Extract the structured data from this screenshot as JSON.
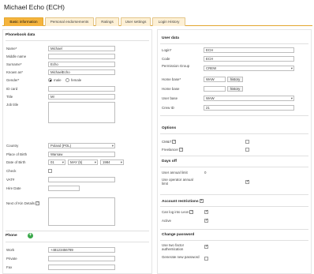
{
  "title": "Michael Echo (ECH)",
  "tabs": [
    "Basic information",
    "Personal endorsements",
    "Ratings",
    "User settings",
    "Login History"
  ],
  "phonebook": {
    "heading": "Phonebook data",
    "name_label": "Name*",
    "name_value": "Michael",
    "middle_label": "Middle name",
    "middle_value": "",
    "surname_label": "Surname*",
    "surname_value": "Echo",
    "known_label": "Known as*",
    "known_value": "MichaelEcho",
    "gender_label": "Gender*",
    "gender_male": "male",
    "gender_female": "female",
    "idcard_label": "ID card",
    "idcard_value": "",
    "title_label": "Title",
    "title_value": "Mr",
    "jobtitle_label": "Job title",
    "country_label": "Country",
    "country_value": "Poland (POL)",
    "pob_label": "Place of Birth",
    "pob_value": "Warsaw",
    "dob_label": "Date of Birth",
    "dob_day": "01",
    "dob_month": "MAY (5)",
    "dob_year": "1984",
    "check_label": "Check",
    "vat_label": "VAT#",
    "hire_label": "Hire Date",
    "nok_label": "Next of Kin Details"
  },
  "phone": {
    "heading": "Phone",
    "work_label": "Work",
    "work_value": "+48123456789",
    "private_label": "Private",
    "fax_label": "Fax"
  },
  "user": {
    "heading": "User data",
    "login_label": "Login*",
    "login_value": "ECH",
    "code_label": "Code",
    "code_value": "ECH",
    "perm_label": "Permission Group",
    "perm_value": "CREW",
    "home_base_label": "Home base*",
    "home_base_value": "WAW",
    "home_base2_label": "Home base",
    "history_label": "history",
    "user_base_label": "User base",
    "user_base_value": "WAW",
    "crew_label": "Crew ID",
    "crew_value": "21"
  },
  "options": {
    "heading": "Options",
    "cm_label": "CM&T",
    "freelancer_label": "Freelancer"
  },
  "daysoff": {
    "heading": "Days off",
    "annual_label": "User annual limit",
    "annual_value": "0",
    "operator_label": "Use operator annual limit"
  },
  "account": {
    "heading": "Account restrictions",
    "canlog_label": "Can log into Leon",
    "active_label": "Active"
  },
  "password": {
    "heading": "Change password",
    "twofactor_label": "Use two factor authentication",
    "generate_label": "Generate new password"
  },
  "colors": {
    "tab_active": "#f5b43d",
    "tab_inactive": "#fdf0d5",
    "tab_border": "#e3a72f",
    "add_green": "#3aa84a"
  }
}
